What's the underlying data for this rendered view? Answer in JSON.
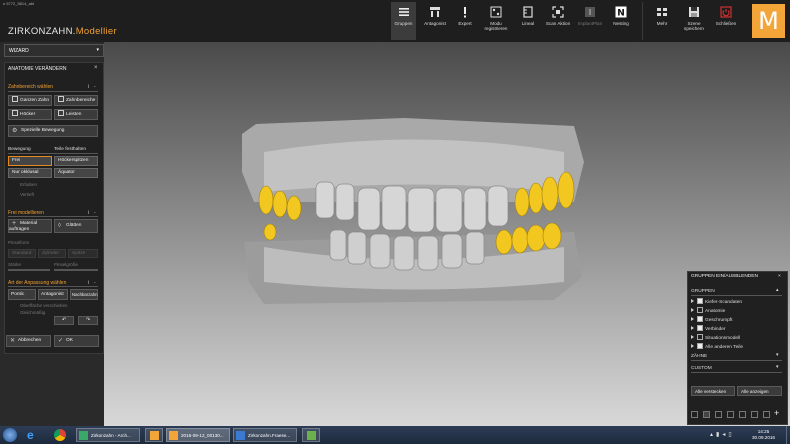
{
  "window_title": "n 5772_5814_abt",
  "app": {
    "brand_part1": "ZIRKONZAHN.",
    "brand_part2": "Modellier",
    "logo_letter": "M"
  },
  "toolbar": {
    "items": [
      {
        "label": "Gruppen",
        "icon": "groups-icon",
        "active": true
      },
      {
        "label": "Antagonist",
        "icon": "antagonist-icon"
      },
      {
        "label": "Expert",
        "icon": "exclamation-icon"
      },
      {
        "label": "Modu registrieren",
        "icon": "register-icon"
      },
      {
        "label": "Lineal",
        "icon": "ruler-icon"
      },
      {
        "label": "Scan Aktion",
        "icon": "scan-icon"
      },
      {
        "label": "ImplantPlan",
        "icon": "implant-icon",
        "disabled": true
      },
      {
        "label": "Nesting",
        "icon": "nesting-icon"
      }
    ],
    "right_items": [
      {
        "label": "Mehr",
        "icon": "more-icon"
      },
      {
        "label": "Szene speichern",
        "icon": "save-icon"
      },
      {
        "label": "Schließen",
        "icon": "power-icon"
      }
    ]
  },
  "left_panel": {
    "wizard_label": "WIZARD",
    "panel_title": "ANATOMIE VERÄNDERN",
    "close": "×",
    "section1": {
      "title": "Zahnbereich wählen",
      "info": "i",
      "collapse": "-",
      "buttons": [
        "Ganzen Zahn",
        "Zahnbereiche",
        "Höcker",
        "Leisten"
      ],
      "special": "Spezielle Bewegung"
    },
    "movement": {
      "label": "Bewegung",
      "options": [
        "Frei",
        "Nur okklusal"
      ]
    },
    "parts": {
      "label": "Teile festhalten",
      "options": [
        "Höckerspitzen",
        "Äquator"
      ]
    },
    "disabled_items": [
      "Erhaben",
      "Vertieft"
    ],
    "section2": {
      "title": "Frei modellieren",
      "info": "i",
      "collapse": "-",
      "buttons": [
        "Material auftragen",
        "Glätten"
      ],
      "pinsel_label": "Pinselform",
      "pinsel_options": [
        "Standard",
        "Zylinder",
        "Spitze"
      ],
      "staerke_label": "Stärke",
      "pinsel_size_label": "Pinselgröße"
    },
    "section3": {
      "title": "Art der Anpassung wählen",
      "info": "i",
      "collapse": "-",
      "buttons": [
        "Pontic",
        "Antagonist",
        "Nachbarzahn"
      ],
      "disabled_text": [
        "Oberfläche verschieben",
        "Gleichmäßig"
      ]
    },
    "undo_icons": [
      "undo-icon",
      "redo-icon"
    ],
    "cancel_label": "Abbrechen",
    "ok_label": "OK"
  },
  "groups_panel": {
    "title": "GRUPPEN EIN/AUSBLENDEN",
    "close": "×",
    "section_gruppen": "GRUPPEN",
    "rows": [
      {
        "label": "Kiefer-Scandaten",
        "checked": true
      },
      {
        "label": "Anatomie",
        "checked": false
      },
      {
        "label": "Geschrumpft",
        "checked": true
      },
      {
        "label": "Verbinder",
        "checked": true
      },
      {
        "label": "Situationsmodell",
        "checked": false
      },
      {
        "label": "Alle anderen Teile",
        "checked": true
      }
    ],
    "section_zaehne": "ZÄHNE",
    "section_custom": "CUSTOM",
    "hide_all": "Alle verstecken",
    "show_all": "Alle anzeigen",
    "view_icons": [
      "view-front-icon",
      "view-back-icon",
      "view-left-icon",
      "view-right-icon",
      "view-top-icon",
      "view-bottom-icon",
      "view-iso-icon"
    ],
    "add": "+"
  },
  "taskbar": {
    "items": [
      {
        "label": "Zirkonzahn - Arch...",
        "icon": "archive-icon"
      },
      {
        "label": "",
        "icon": "modellier-n-icon"
      },
      {
        "label": "2016-09-12_00130...",
        "icon": "modellier-m-icon"
      },
      {
        "label": "Zirkonzahn.Fraese...",
        "icon": "fraese-icon"
      },
      {
        "label": "",
        "icon": "tool-icon"
      }
    ],
    "time": "14:25",
    "date": "30.09.2016"
  },
  "colors": {
    "accent": "#f0a030",
    "tooth_highlight": "#f2c820",
    "model_gray": "#b5b5b5"
  }
}
